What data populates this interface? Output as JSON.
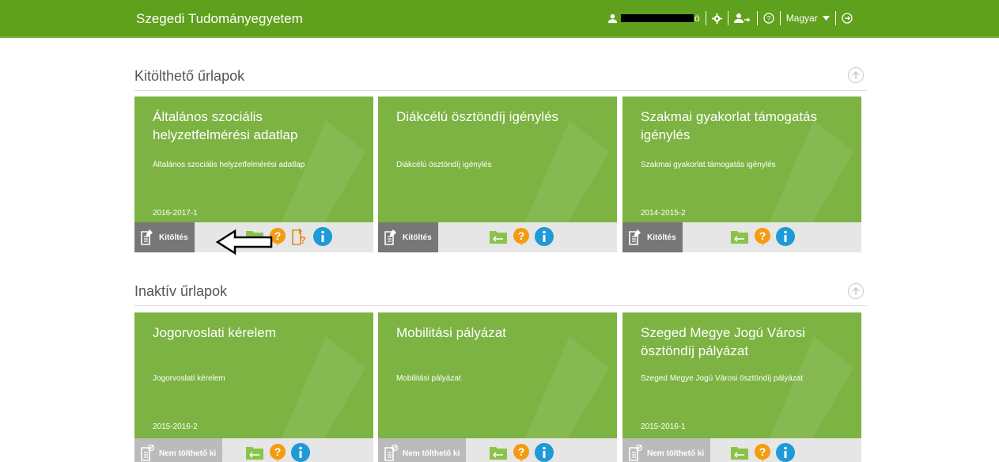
{
  "header": {
    "brand": "Szegedi Tudományegyetem",
    "user_label_tail": "ó",
    "language": "Magyar"
  },
  "sections": [
    {
      "title": "Kitölthető űrlapok",
      "cards": [
        {
          "title": "Általános szociális helyzetfelmérési adatlap",
          "subtitle": "Általános szociális helyzetfelmérési adatlap",
          "period": "2016-2017-1",
          "action": "Kitöltés"
        },
        {
          "title": "Diákcélú ösztöndíj igénylés",
          "subtitle": "Diákcélú ösztöndíj igénylés",
          "period": "",
          "action": "Kitöltés"
        },
        {
          "title": "Szakmai gyakorlat támogatás igénylés",
          "subtitle": "Szakmai gyakorlat támogatás igénylés",
          "period": "2014-2015-2",
          "action": "Kitöltés"
        }
      ]
    },
    {
      "title": "Inaktív űrlapok",
      "cards": [
        {
          "title": "Jogorvoslati kérelem",
          "subtitle": "Jogorvoslati kérelem",
          "period": "2015-2016-2",
          "action": "Nem tölthető ki"
        },
        {
          "title": "Mobilitási pályázat",
          "subtitle": "Mobilitási pályázat",
          "period": "",
          "action": "Nem tölthető ki"
        },
        {
          "title": "Szeged Megye Jogú Városi ösztöndíj pályázat",
          "subtitle": "Szeged Megye Jogú Városi ösztöndíj pályázat",
          "period": "2015-2016-1",
          "action": "Nem tölthető ki"
        }
      ]
    }
  ],
  "colors": {
    "header": "#5fa01c",
    "card": "#7cb342",
    "info_icon": "#1e9ad6",
    "help_icon": "#f39c12"
  }
}
